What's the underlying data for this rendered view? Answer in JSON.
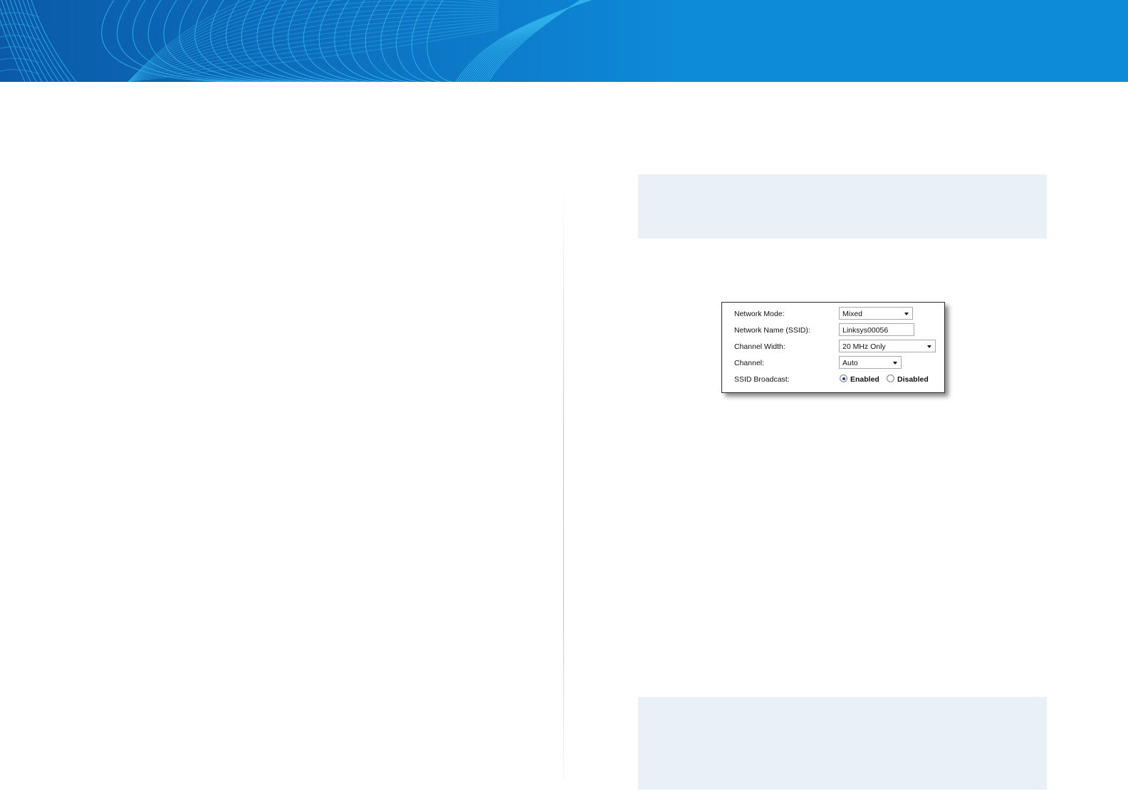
{
  "colors": {
    "banner": "#0d8ad8",
    "note_background": "#e9f0f8",
    "radio_selected": "#1d3f86"
  },
  "wireless_settings": {
    "network_mode": {
      "label": "Network Mode:",
      "value": "Mixed"
    },
    "network_name": {
      "label": "Network Name (SSID):",
      "value": "Linksys00056"
    },
    "channel_width": {
      "label": "Channel Width:",
      "value": "20 MHz Only"
    },
    "channel": {
      "label": "Channel:",
      "value": "Auto"
    },
    "ssid_broadcast": {
      "label": "SSID Broadcast:",
      "options": [
        "Enabled",
        "Disabled"
      ],
      "selected": "Enabled"
    }
  },
  "icons": [
    "dropdown-arrow-icon",
    "radio-button-icon"
  ]
}
